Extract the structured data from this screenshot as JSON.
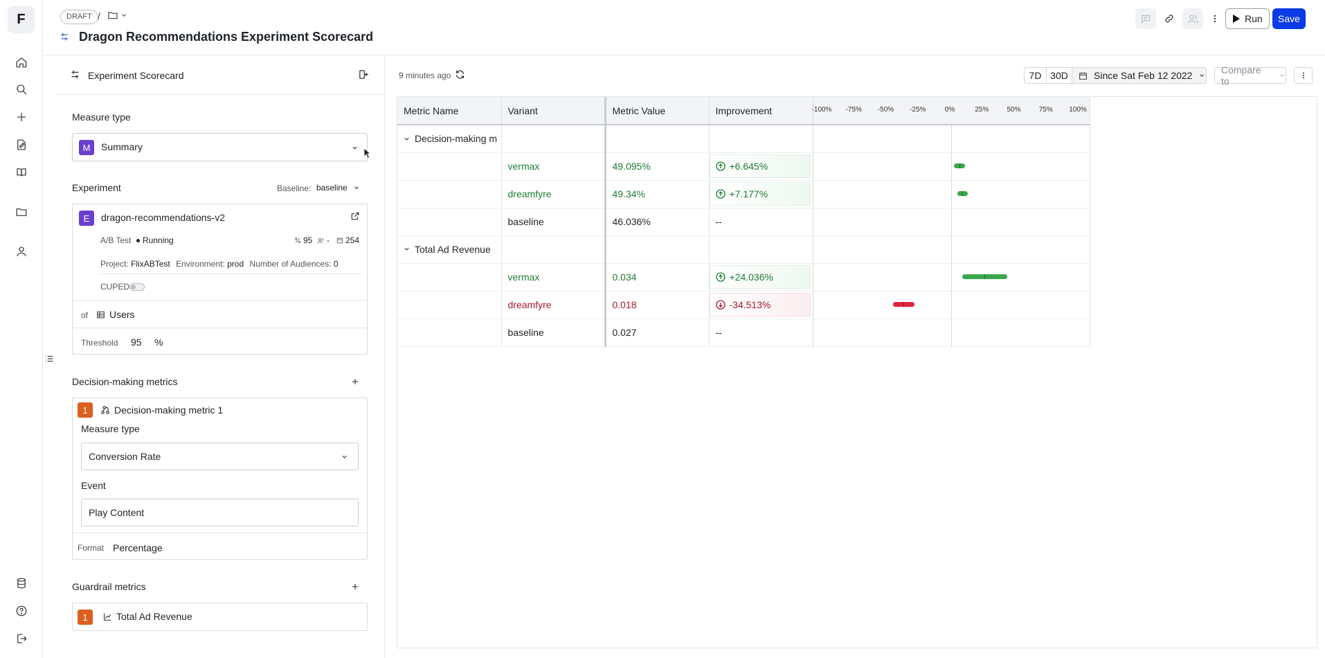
{
  "app": {
    "logo_letter": "F"
  },
  "rail_icons": [
    "home-icon",
    "search-icon",
    "plus-icon",
    "edit-doc-icon",
    "book-icon",
    "folder-icon",
    "user-icon",
    "database-icon",
    "help-icon",
    "logout-icon"
  ],
  "header": {
    "draft_label": "DRAFT",
    "breadcrumb_separator": "/",
    "title": "Dragon Recommendations Experiment Scorecard",
    "run_label": "Run",
    "save_label": "Save"
  },
  "side": {
    "title": "Experiment Scorecard",
    "measure_type_label": "Measure type",
    "measure_type": {
      "badge": "M",
      "value": "Summary"
    },
    "experiment_label": "Experiment",
    "baseline_label": "Baseline:",
    "baseline_value": "baseline",
    "experiment": {
      "badge": "E",
      "name": "dragon-recommendations-v2",
      "kind": "A/B Test",
      "status": "Running",
      "confidence": "95",
      "audience": "-",
      "days": "254",
      "project_label": "Project:",
      "project": "FlixABTest",
      "environment_label": "Environment:",
      "environment": "prod",
      "audiences_label": "Number of Audiences:",
      "audiences": "0",
      "cuped_label": "CUPED:"
    },
    "of_label": "of",
    "unit": "Users",
    "threshold_label": "Threshold",
    "threshold_value": "95",
    "threshold_unit": "%",
    "decision_section": "Decision-making metrics",
    "decision_metric": {
      "index": "1",
      "name": "Decision-making metric 1",
      "measure_type_label": "Measure type",
      "measure_type": "Conversion Rate",
      "event_label": "Event",
      "event": "Play Content",
      "format_label": "Format",
      "format": "Percentage"
    },
    "guardrail_section": "Guardrail metrics",
    "guardrail_metric": {
      "index": "1",
      "name": "Total Ad Revenue"
    }
  },
  "results": {
    "updated": "9 minutes ago",
    "range_7d": "7D",
    "range_30d": "30D",
    "since": "Since Sat Feb 12 2022",
    "compare_placeholder": "Compare to",
    "columns": {
      "metric": "Metric Name",
      "variant": "Variant",
      "value": "Metric Value",
      "improvement": "Improvement"
    },
    "ticks": [
      "-100%",
      "-75%",
      "-50%",
      "-25%",
      "0%",
      "25%",
      "50%",
      "75%",
      "100%"
    ],
    "groups": [
      {
        "name": "Decision-making m",
        "rows": [
          {
            "variant": "vermax",
            "value": "49.095%",
            "improvement": "+6.645%",
            "direction": "up",
            "ci": [
              2,
              11
            ]
          },
          {
            "variant": "dreamfyre",
            "value": "49.34%",
            "improvement": "+7.177%",
            "direction": "up",
            "ci": [
              5,
              13
            ]
          },
          {
            "variant": "baseline",
            "value": "46.036%",
            "improvement": "--",
            "direction": "none"
          }
        ]
      },
      {
        "name": "Total Ad Revenue",
        "rows": [
          {
            "variant": "vermax",
            "value": "0.034",
            "improvement": "+24.036%",
            "direction": "up",
            "ci": [
              9,
              44
            ]
          },
          {
            "variant": "dreamfyre",
            "value": "0.018",
            "improvement": "-34.513%",
            "direction": "down",
            "ci": [
              -46,
              -29
            ]
          },
          {
            "variant": "baseline",
            "value": "0.027",
            "improvement": "--",
            "direction": "none"
          }
        ]
      }
    ]
  },
  "colors": {
    "accent": "#0b3be6",
    "positive": "#1e7d35",
    "negative": "#a31a2c",
    "bar_pos": "#3aa64c",
    "bar_neg": "#e0243c"
  }
}
